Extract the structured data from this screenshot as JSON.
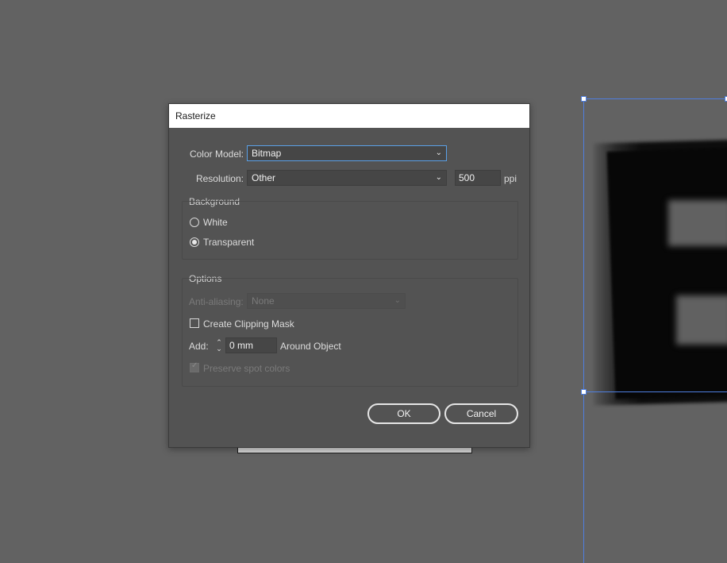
{
  "dialog": {
    "title": "Rasterize",
    "color_model": {
      "label": "Color Model:",
      "value": "Bitmap"
    },
    "resolution": {
      "label": "Resolution:",
      "value": "Other",
      "ppi_value": "500",
      "unit": "ppi"
    },
    "background": {
      "title": "Background",
      "options": [
        {
          "label": "White",
          "selected": false
        },
        {
          "label": "Transparent",
          "selected": true
        }
      ]
    },
    "options": {
      "title": "Options",
      "anti_aliasing": {
        "label": "Anti-aliasing:",
        "value": "None",
        "enabled": false
      },
      "clipping_mask": {
        "label": "Create Clipping Mask",
        "checked": false
      },
      "add": {
        "label": "Add:",
        "value": "0 mm",
        "suffix": "Around Object"
      },
      "preserve_spot": {
        "label": "Preserve spot colors",
        "checked": true,
        "enabled": false
      }
    },
    "buttons": {
      "ok": "OK",
      "cancel": "Cancel"
    }
  },
  "icons": [
    "chevron-down-icon",
    "stepper-icon",
    "checkmark-icon"
  ],
  "colors": {
    "canvas": "#626262",
    "dialog": "#535353",
    "focus": "#5aa0e6",
    "selection": "#4f7fe0"
  }
}
